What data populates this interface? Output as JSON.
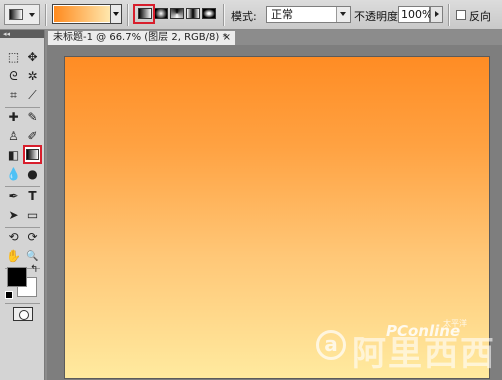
{
  "options_bar": {
    "tool_preset_icon": "gradient-tool-icon",
    "gradient_preview": {
      "start_color": "#ff8a1e",
      "end_color": "#ffe9b0"
    },
    "gradient_types": [
      "linear",
      "radial",
      "angle",
      "reflected",
      "diamond"
    ],
    "selected_gradient_type": "linear",
    "mode_label": "模式:",
    "mode_value": "正常",
    "opacity_label": "不透明度:",
    "opacity_value": "100%",
    "reverse_label": "反向",
    "reverse_checked": false
  },
  "document": {
    "tab_title": "未标题-1 @ 66.7% (图层 2, RGB/8) *",
    "close_glyph": "×",
    "canvas_gradient": {
      "top_color": "#ff8c24",
      "bottom_color": "#ffea9f"
    }
  },
  "toolbox": {
    "header": "◂◂",
    "tools": [
      {
        "name": "marquee-tool-icon",
        "glyph": "⬚"
      },
      {
        "name": "move-tool-icon",
        "glyph": "✥"
      },
      {
        "name": "lasso-tool-icon",
        "glyph": "ᘓ"
      },
      {
        "name": "magic-wand-tool-icon",
        "glyph": "✲"
      },
      {
        "name": "crop-tool-icon",
        "glyph": "⌗"
      },
      {
        "name": "eyedropper-tool-icon",
        "glyph": "⟋"
      },
      {
        "name": "healing-brush-tool-icon",
        "glyph": "✚"
      },
      {
        "name": "brush-tool-icon",
        "glyph": "✎"
      },
      {
        "name": "clone-stamp-tool-icon",
        "glyph": "♙"
      },
      {
        "name": "history-brush-tool-icon",
        "glyph": "✐"
      },
      {
        "name": "eraser-tool-icon",
        "glyph": "◧"
      },
      {
        "name": "gradient-tool-icon",
        "glyph": ""
      },
      {
        "name": "blur-tool-icon",
        "glyph": "💧"
      },
      {
        "name": "dodge-tool-icon",
        "glyph": "●"
      },
      {
        "name": "pen-tool-icon",
        "glyph": "✒"
      },
      {
        "name": "type-tool-icon",
        "glyph": "T"
      },
      {
        "name": "path-selection-tool-icon",
        "glyph": "➤"
      },
      {
        "name": "shape-tool-icon",
        "glyph": "▭"
      },
      {
        "name": "3d-rotate-tool-icon",
        "glyph": "⟲"
      },
      {
        "name": "3d-orbit-tool-icon",
        "glyph": "⟳"
      },
      {
        "name": "hand-tool-icon",
        "glyph": "✋"
      },
      {
        "name": "zoom-tool-icon",
        "glyph": "🔍"
      }
    ],
    "foreground_color": "#000000",
    "background_color": "#ffffff",
    "swap_glyph": "↰",
    "quick_mask_icon": "quick-mask-icon"
  },
  "watermark": {
    "circle_letter": "a",
    "main_text": "阿里西西",
    "brand": "PConline",
    "small": "太平洋"
  }
}
